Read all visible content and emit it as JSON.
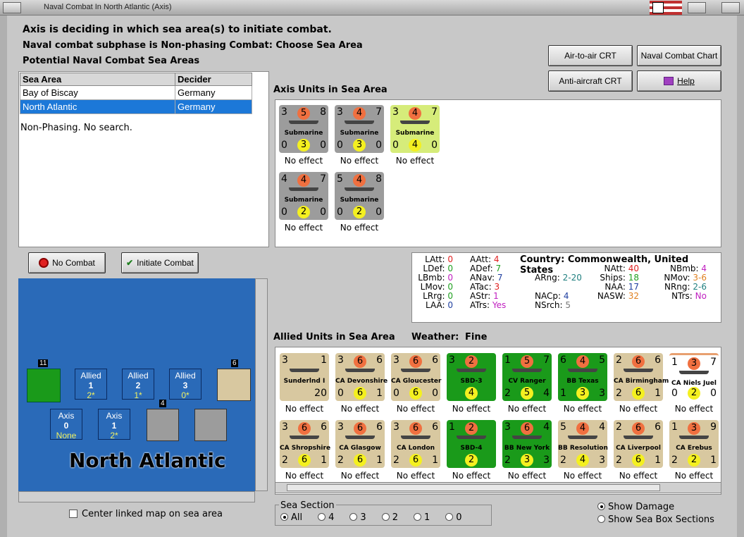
{
  "window": {
    "title": "Naval Combat In North Atlantic (Axis)"
  },
  "header": {
    "line1": "Axis is deciding in which sea area(s) to initiate combat.",
    "line2": "Naval combat subphase is Non-phasing Combat: Choose Sea Area",
    "line3": "Potential Naval Combat Sea Areas"
  },
  "buttons": {
    "air_to_air": "Air-to-air CRT",
    "naval_chart": "Naval Combat Chart",
    "anti_aircraft": "Anti-aircraft CRT",
    "help": "Help",
    "no_combat": "No Combat",
    "initiate": "Initiate Combat"
  },
  "sea_table": {
    "headers": [
      "Sea Area",
      "Decider"
    ],
    "rows": [
      {
        "area": "Bay of Biscay",
        "decider": "Germany"
      },
      {
        "area": "North Atlantic",
        "decider": "Germany"
      }
    ],
    "status": "Non-Phasing.  No search."
  },
  "axis_panel": {
    "title": "Axis Units in Sea Area",
    "units": [
      {
        "tl": "3",
        "top": "5",
        "tr": "8",
        "name": "Submarine",
        "bl": "0",
        "bot": "3",
        "br": "0",
        "effect": "No effect",
        "style": "gray"
      },
      {
        "tl": "3",
        "top": "4",
        "tr": "7",
        "name": "Submarine",
        "bl": "0",
        "bot": "3",
        "br": "0",
        "effect": "No effect",
        "style": "gray"
      },
      {
        "tl": "3",
        "top": "4",
        "tr": "7",
        "name": "Submarine",
        "bl": "0",
        "bot": "4",
        "br": "0",
        "effect": "No effect",
        "style": "lime"
      },
      {
        "tl": "4",
        "top": "4",
        "tr": "7",
        "name": "Submarine",
        "bl": "0",
        "bot": "2",
        "br": "0",
        "effect": "No effect",
        "style": "gray"
      },
      {
        "tl": "5",
        "top": "4",
        "tr": "8",
        "name": "Submarine",
        "bl": "0",
        "bot": "2",
        "br": "0",
        "effect": "No effect",
        "style": "gray"
      }
    ]
  },
  "stats": {
    "LAtt": "0",
    "LDef": "0",
    "LBmb": "0",
    "LMov": "0",
    "LRrg": "0",
    "LAA": "0",
    "AAtt": "4",
    "ADef": "7",
    "ANav": "7",
    "ATac": "3",
    "AStr": "1",
    "ATrs": "Yes",
    "ARng": "2-20",
    "NACp": "4",
    "NSrch": "5",
    "country_label": "Country:",
    "country": "Commonwealth, United States",
    "NAtt": "40",
    "Ships": "18",
    "NAA": "17",
    "NASW": "32",
    "NBmb": "4",
    "NMov": "3-6",
    "NRng": "2-6",
    "NTrs": "No"
  },
  "allied_panel": {
    "title": "Allied Units in Sea Area",
    "weather_label": "Weather:",
    "weather": "Fine",
    "units": [
      {
        "tl": "3",
        "top": "",
        "tr": "1",
        "name": "Sunderlnd I",
        "bl": "",
        "bot": "",
        "br": "20",
        "effect": "No effect",
        "style": "tan"
      },
      {
        "tl": "3",
        "top": "6",
        "tr": "6",
        "name": "CA Devonshire",
        "bl": "0",
        "bot": "6",
        "br": "1",
        "effect": "No effect",
        "style": "tan"
      },
      {
        "tl": "3",
        "top": "6",
        "tr": "6",
        "name": "CA Gloucester",
        "bl": "0",
        "bot": "6",
        "br": "0",
        "effect": "No effect",
        "style": "tan"
      },
      {
        "tl": "3",
        "top": "2",
        "tr": "",
        "name": "SBD-3",
        "bl": "",
        "bot": "4",
        "br": "",
        "effect": "No effect",
        "style": "green"
      },
      {
        "tl": "1",
        "top": "5",
        "tr": "7",
        "name": "CV Ranger",
        "bl": "2",
        "bot": "5",
        "br": "4",
        "effect": "No effect",
        "style": "green"
      },
      {
        "tl": "6",
        "top": "4",
        "tr": "5",
        "name": "BB Texas",
        "bl": "1",
        "bot": "3",
        "br": "3",
        "effect": "No effect",
        "style": "green"
      },
      {
        "tl": "2",
        "top": "6",
        "tr": "6",
        "name": "CA Birmingham",
        "bl": "2",
        "bot": "6",
        "br": "1",
        "effect": "No effect",
        "style": "tan"
      },
      {
        "tl": "1",
        "top": "3",
        "tr": "7",
        "name": "CA Niels Juel",
        "bl": "0",
        "bot": "2",
        "br": "0",
        "effect": "No effect",
        "style": "white"
      },
      {
        "tl": "3",
        "top": "6",
        "tr": "6",
        "name": "CA Shropshire",
        "bl": "2",
        "bot": "6",
        "br": "1",
        "effect": "No effect",
        "style": "tan"
      },
      {
        "tl": "3",
        "top": "6",
        "tr": "6",
        "name": "CA Glasgow",
        "bl": "2",
        "bot": "6",
        "br": "1",
        "effect": "No effect",
        "style": "tan"
      },
      {
        "tl": "3",
        "top": "6",
        "tr": "6",
        "name": "CA London",
        "bl": "2",
        "bot": "6",
        "br": "1",
        "effect": "No effect",
        "style": "tan"
      },
      {
        "tl": "1",
        "top": "2",
        "tr": "",
        "name": "SBD-4",
        "bl": "",
        "bot": "2",
        "br": "",
        "effect": "No effect",
        "style": "green"
      },
      {
        "tl": "3",
        "top": "6",
        "tr": "4",
        "name": "BB New York",
        "bl": "2",
        "bot": "3",
        "br": "3",
        "effect": "No effect",
        "style": "green"
      },
      {
        "tl": "5",
        "top": "4",
        "tr": "4",
        "name": "BB Resolution",
        "bl": "2",
        "bot": "4",
        "br": "3",
        "effect": "No effect",
        "style": "tan"
      },
      {
        "tl": "2",
        "top": "6",
        "tr": "6",
        "name": "CA Liverpool",
        "bl": "2",
        "bot": "6",
        "br": "1",
        "effect": "No effect",
        "style": "tan"
      },
      {
        "tl": "1",
        "top": "3",
        "tr": "9",
        "name": "CA Erebus",
        "bl": "2",
        "bot": "2",
        "br": "1",
        "effect": "No effect",
        "style": "tan"
      }
    ]
  },
  "map": {
    "sea_name": "North Atlantic",
    "allied_boxes": [
      {
        "label": "Allied",
        "num": "1",
        "val": "2*"
      },
      {
        "label": "Allied",
        "num": "2",
        "val": "1*"
      },
      {
        "label": "Allied",
        "num": "3",
        "val": "0*"
      }
    ],
    "axis_boxes": [
      {
        "label": "Axis",
        "num": "0",
        "val": "None"
      },
      {
        "label": "Axis",
        "num": "1",
        "val": "2*"
      }
    ],
    "stack1": "11",
    "stack2": "4",
    "stack3": "6",
    "center_label": "Center linked map on sea area"
  },
  "sea_section": {
    "title": "Sea Section",
    "options": [
      "All",
      "4",
      "3",
      "2",
      "1",
      "0"
    ]
  },
  "show": {
    "damage": "Show Damage",
    "sections": "Show Sea Box Sections"
  }
}
